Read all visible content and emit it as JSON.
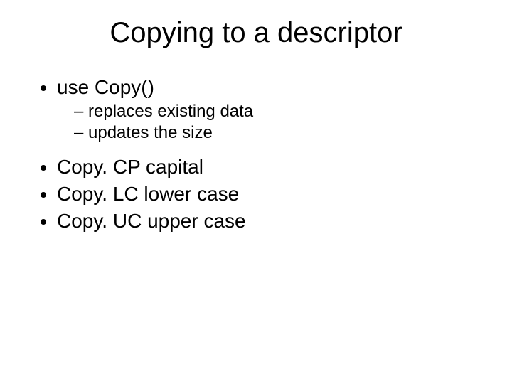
{
  "slide": {
    "title": "Copying to a descriptor",
    "bullets": {
      "b1": "use Copy()",
      "b1_sub1": "replaces existing data",
      "b1_sub2": "updates the size",
      "b2": "Copy. CP capital",
      "b3": "Copy. LC lower case",
      "b4": "Copy. UC upper case"
    }
  }
}
